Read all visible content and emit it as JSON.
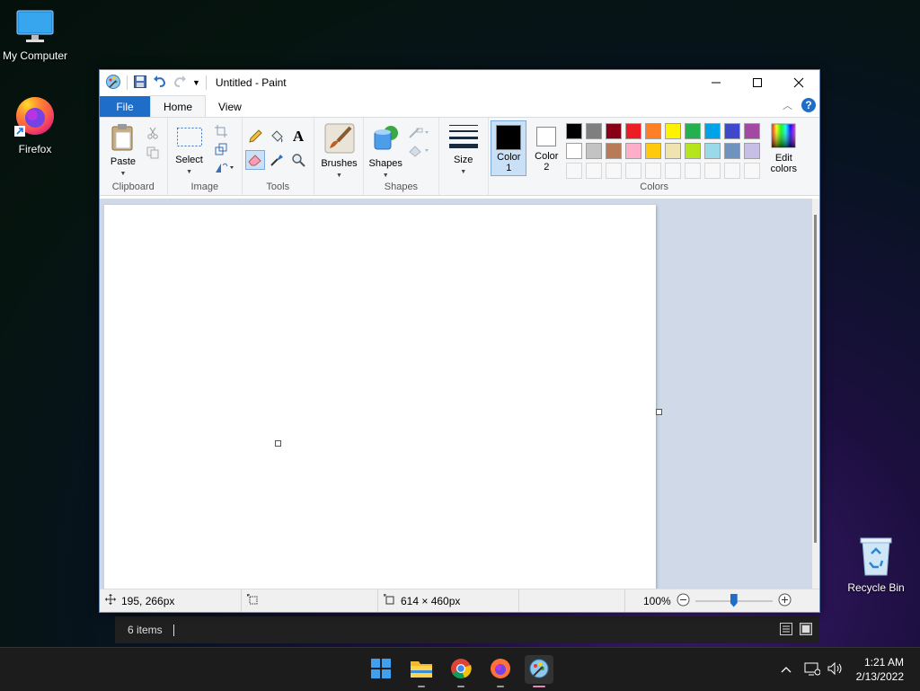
{
  "desktop": {
    "icons": [
      {
        "label": "My Computer"
      },
      {
        "label": "Firefox"
      },
      {
        "label": "Recycle Bin"
      }
    ]
  },
  "window": {
    "title": "Untitled - Paint",
    "tabs": {
      "file": "File",
      "home": "Home",
      "view": "View"
    },
    "help": "?"
  },
  "ribbon": {
    "clipboard": {
      "label": "Clipboard",
      "paste": "Paste"
    },
    "image": {
      "label": "Image",
      "select": "Select"
    },
    "tools": {
      "label": "Tools"
    },
    "brushes": "Brushes",
    "shapes": {
      "label": "Shapes",
      "button": "Shapes"
    },
    "size": "Size",
    "colors": {
      "label": "Colors",
      "color1": "Color 1",
      "color1_a": "Color",
      "color1_b": "1",
      "color2_a": "Color",
      "color2_b": "2",
      "edit_a": "Edit",
      "edit_b": "colors",
      "color1_value": "#000000",
      "color2_value": "#ffffff",
      "palette_row1": [
        "#000000",
        "#7f7f7f",
        "#880015",
        "#ed1c24",
        "#ff7f27",
        "#fff200",
        "#22b14c",
        "#00a2e8",
        "#3f48cc",
        "#a349a4"
      ],
      "palette_row2": [
        "#ffffff",
        "#c3c3c3",
        "#b97a57",
        "#ffaec9",
        "#ffc90e",
        "#efe4b0",
        "#b5e61d",
        "#99d9ea",
        "#7092be",
        "#c8bfe7"
      ]
    }
  },
  "statusbar": {
    "cursor_pos": "195, 266px",
    "canvas_size": "614 × 460px",
    "zoom": "100%",
    "zoom_level": 0.5
  },
  "explorer": {
    "items": "6 items"
  },
  "taskbar": {
    "time": "1:21 AM",
    "date": "2/13/2022"
  }
}
